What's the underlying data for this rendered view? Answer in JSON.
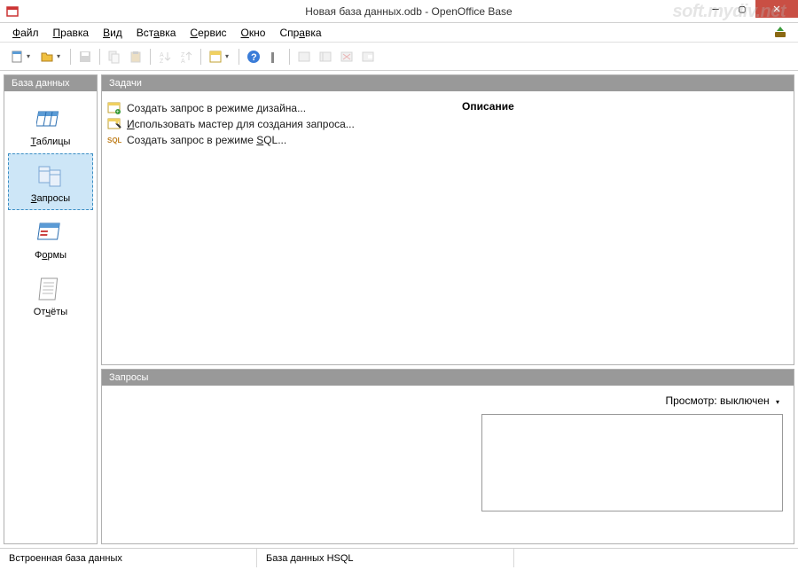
{
  "window": {
    "title": "Новая база данных.odb - OpenOffice Base",
    "watermark": "soft.mydiv.net"
  },
  "menu": {
    "file": "Файл",
    "edit": "Правка",
    "view": "Вид",
    "insert": "Вставка",
    "tools": "Сервис",
    "window": "Окно",
    "help": "Справка"
  },
  "sidebar": {
    "header": "База данных",
    "items": {
      "tables": "Таблицы",
      "queries": "Запросы",
      "forms": "Формы",
      "reports": "Отчёты"
    }
  },
  "tasks": {
    "header": "Задачи",
    "design": "Создать запрос в режиме дизайна...",
    "wizard": "Использовать мастер для создания запроса...",
    "sql": "Создать запрос в режиме SQL...",
    "description_label": "Описание"
  },
  "queries_panel": {
    "header": "Запросы",
    "preview_label": "Просмотр: выключен"
  },
  "status": {
    "embedded": "Встроенная база данных",
    "engine": "База данных HSQL"
  }
}
